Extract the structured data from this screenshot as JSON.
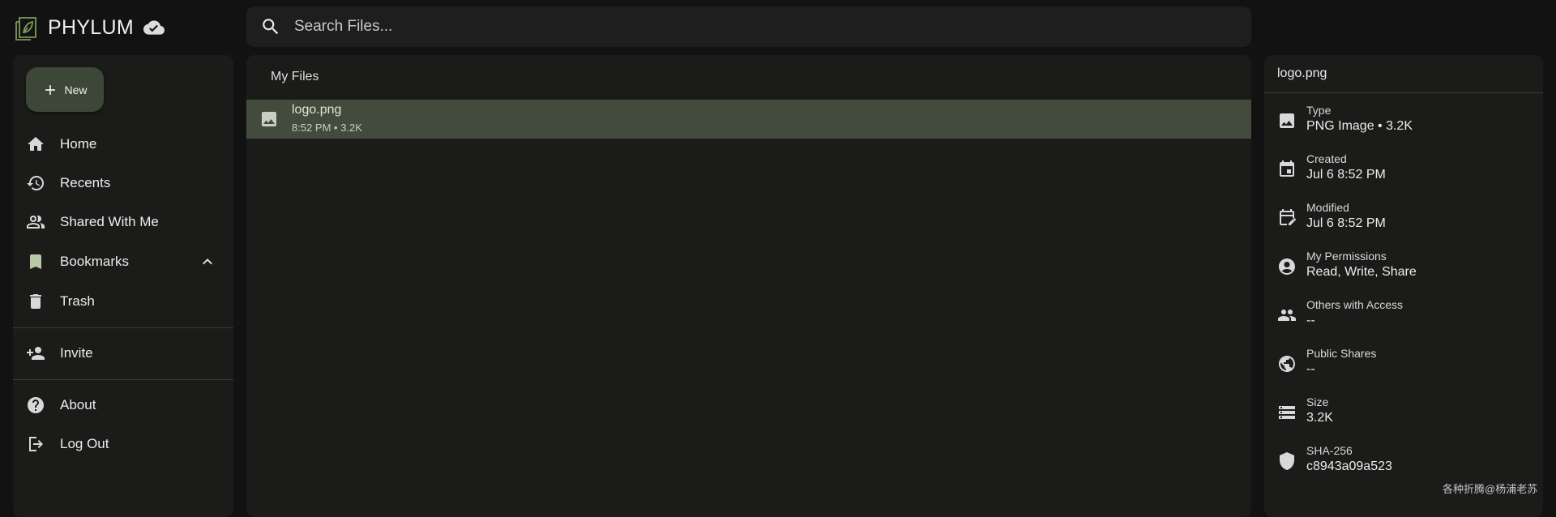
{
  "app": {
    "name": "PHYLUM",
    "logo_icon": "leaf-page-icon",
    "sync_icon": "cloud-done-icon",
    "accent_color": "#7a9a5c"
  },
  "search": {
    "placeholder": "Search Files...",
    "value": "",
    "icon": "search-icon"
  },
  "sidebar": {
    "new_button": {
      "label": "New",
      "icon": "plus-icon"
    },
    "items": [
      {
        "label": "Home",
        "icon": "home-icon"
      },
      {
        "label": "Recents",
        "icon": "history-icon"
      },
      {
        "label": "Shared With Me",
        "icon": "people-icon"
      },
      {
        "label": "Bookmarks",
        "icon": "bookmark-icon",
        "expanded": true
      },
      {
        "label": "Trash",
        "icon": "trash-icon"
      }
    ],
    "secondary": [
      {
        "label": "Invite",
        "icon": "person-add-icon"
      }
    ],
    "footer": [
      {
        "label": "About",
        "icon": "help-icon"
      },
      {
        "label": "Log Out",
        "icon": "logout-icon"
      }
    ]
  },
  "main": {
    "title": "My Files",
    "files": [
      {
        "name": "logo.png",
        "meta": "8:52 PM • 3.2K",
        "icon": "image-icon",
        "selected": true,
        "selected_color": "#434c3c"
      }
    ]
  },
  "details": {
    "title": "logo.png",
    "properties": [
      {
        "label": "Type",
        "value": "PNG Image • 3.2K",
        "icon": "image-icon"
      },
      {
        "label": "Created",
        "value": "Jul 6 8:52 PM",
        "icon": "calendar-icon"
      },
      {
        "label": "Modified",
        "value": "Jul 6 8:52 PM",
        "icon": "calendar-edit-icon"
      },
      {
        "label": "My Permissions",
        "value": "Read, Write, Share",
        "icon": "account-circle-icon"
      },
      {
        "label": "Others with Access",
        "value": "--",
        "icon": "people-icon"
      },
      {
        "label": "Public Shares",
        "value": "--",
        "icon": "globe-icon"
      },
      {
        "label": "Size",
        "value": "3.2K",
        "icon": "storage-icon"
      },
      {
        "label": "SHA-256",
        "value": "c8943a09a523",
        "icon": "shield-icon"
      }
    ]
  },
  "watermark": "各种折腾@杨浦老苏"
}
